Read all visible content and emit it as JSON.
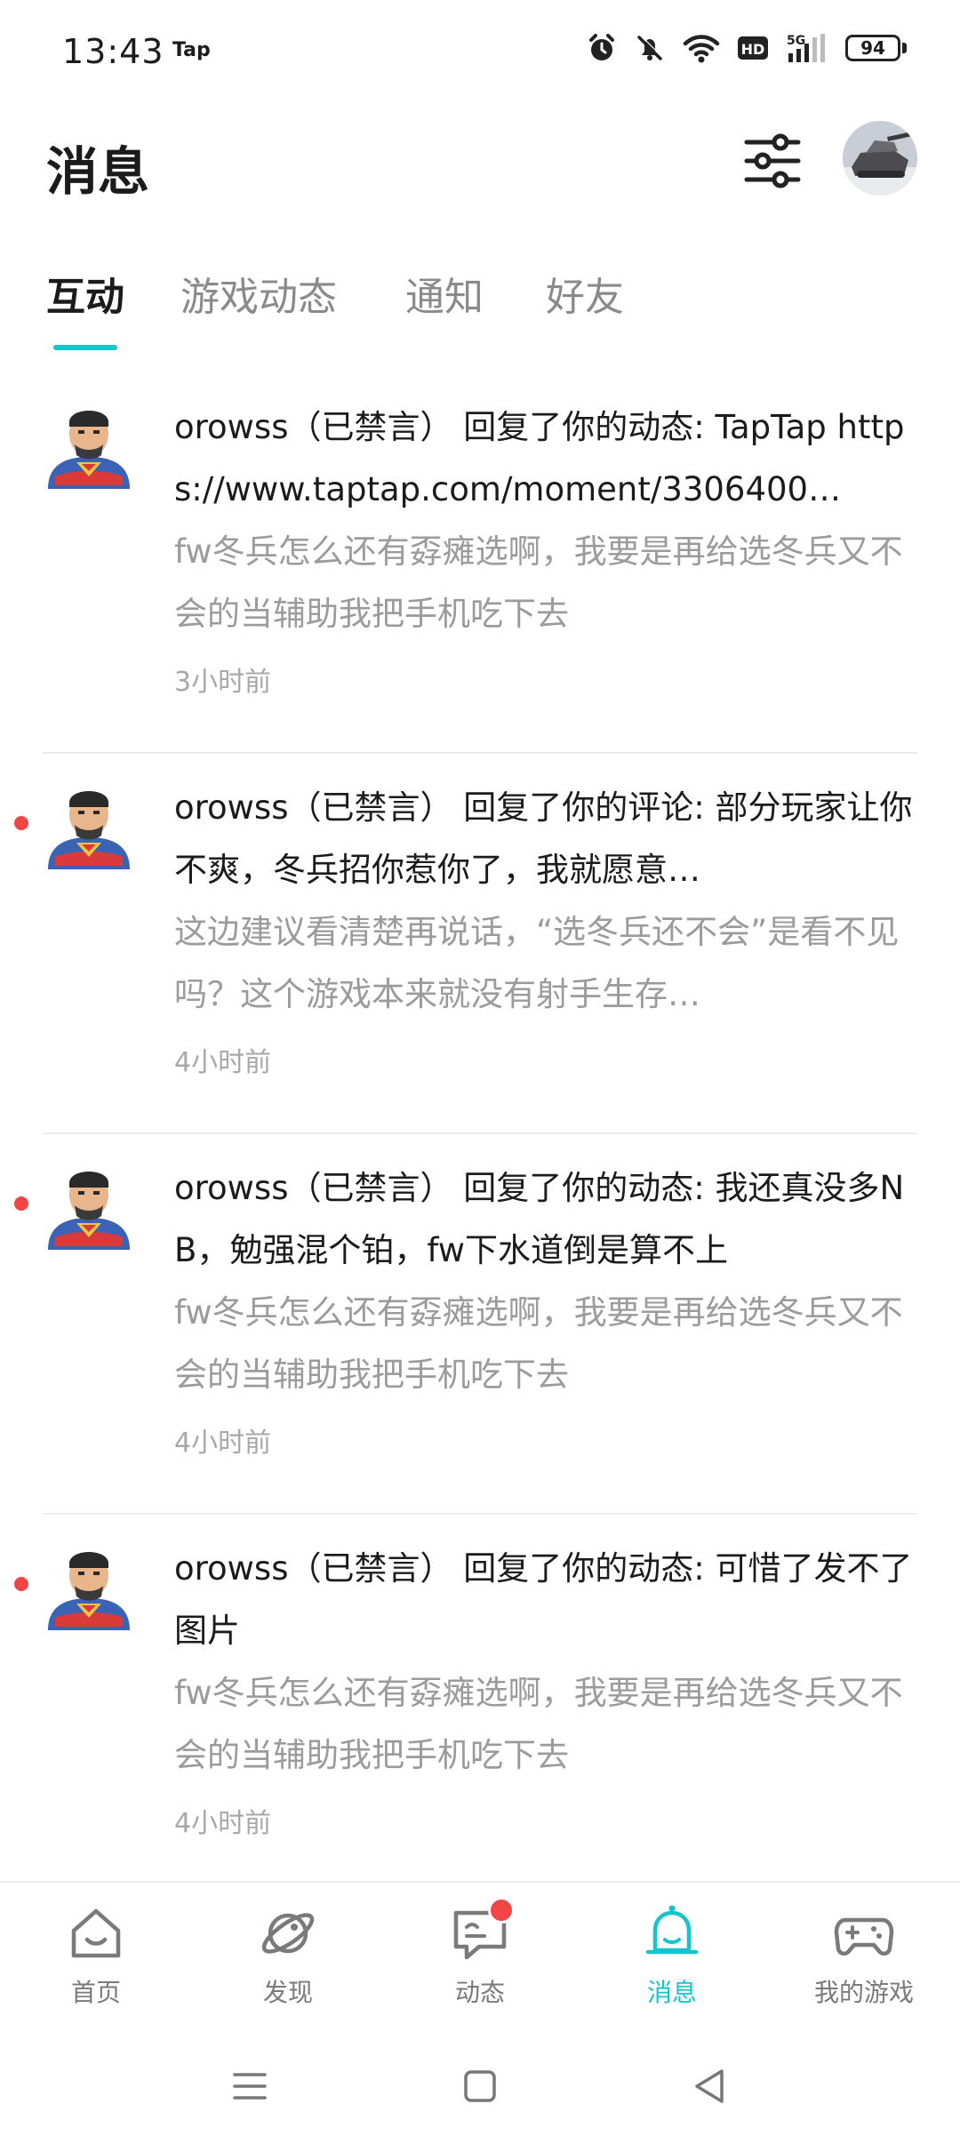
{
  "status_bar": {
    "time": "13:43",
    "app_label": "Tap",
    "network": "5G",
    "hd": "HD",
    "battery": "94"
  },
  "header": {
    "title": "消息"
  },
  "tabs": [
    {
      "label": "互动",
      "active": true
    },
    {
      "label": "游戏动态",
      "active": false
    },
    {
      "label": "通知",
      "active": false
    },
    {
      "label": "好友",
      "active": false
    }
  ],
  "messages": [
    {
      "title": "orowss（已禁言） 回复了你的动态: TapTap https://www.taptap.com/moment/3306400…",
      "quote": "fw冬兵怎么还有孬瘫选啊，我要是再给选冬兵又不会的当辅助我把手机吃下去",
      "time": "3小时前",
      "unread": false
    },
    {
      "title": "orowss（已禁言） 回复了你的评论: 部分玩家让你不爽，冬兵招你惹你了，我就愿意…",
      "quote": "这边建议看清楚再说话，“选冬兵还不会”是看不见吗？这个游戏本来就没有射手生存…",
      "time": "4小时前",
      "unread": true
    },
    {
      "title": "orowss（已禁言） 回复了你的动态: 我还真没多NB，勉强混个铂，fw下水道倒是算不上",
      "quote": "fw冬兵怎么还有孬瘫选啊，我要是再给选冬兵又不会的当辅助我把手机吃下去",
      "time": "4小时前",
      "unread": true
    },
    {
      "title": "orowss（已禁言） 回复了你的动态: 可惜了发不了图片",
      "quote": "fw冬兵怎么还有孬瘫选啊，我要是再给选冬兵又不会的当辅助我把手机吃下去",
      "time": "4小时前",
      "unread": true
    }
  ],
  "bottom_nav": [
    {
      "label": "首页",
      "icon": "home-icon",
      "active": false
    },
    {
      "label": "发现",
      "icon": "planet-icon",
      "active": false
    },
    {
      "label": "动态",
      "icon": "chat-icon",
      "active": false,
      "badge": true
    },
    {
      "label": "消息",
      "icon": "bell-icon",
      "active": true
    },
    {
      "label": "我的游戏",
      "icon": "gamepad-icon",
      "active": false
    }
  ],
  "colors": {
    "accent": "#15c5ce",
    "unread": "#f24646",
    "secondary_text": "#9b9b9b"
  }
}
